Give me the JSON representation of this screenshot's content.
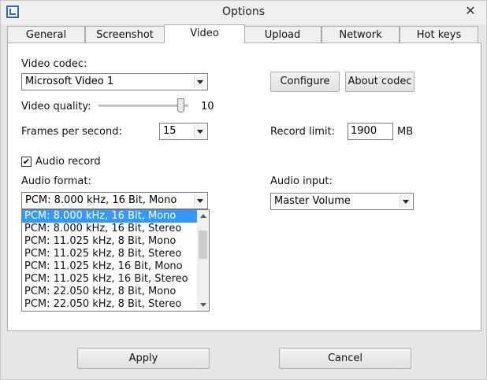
{
  "window": {
    "title": "Options"
  },
  "tabs": [
    {
      "label": "General"
    },
    {
      "label": "Screenshot"
    },
    {
      "label": "Video"
    },
    {
      "label": "Upload"
    },
    {
      "label": "Network"
    },
    {
      "label": "Hot keys"
    }
  ],
  "active_tab": "Video",
  "video": {
    "codec_label": "Video codec:",
    "codec_value": "Microsoft Video 1",
    "configure_label": "Configure",
    "about_codec_label": "About codec",
    "quality_label": "Video quality:",
    "quality_value": "10",
    "quality_fraction": 0.95,
    "fps_label": "Frames per second:",
    "fps_value": "15",
    "record_limit_label": "Record limit:",
    "record_limit_value": "1900",
    "record_limit_unit": "MB"
  },
  "audio": {
    "record_label": "Audio record",
    "record_checked": true,
    "check_glyph": "✔",
    "format_label": "Audio format:",
    "format_value": "PCM: 8.000 kHz, 16 Bit, Mono",
    "input_label": "Audio input:",
    "input_value": "Master Volume",
    "format_options": [
      "PCM: 8.000 kHz, 16 Bit, Mono",
      "PCM: 8.000 kHz, 16 Bit, Stereo",
      "PCM: 11.025 kHz, 8 Bit, Mono",
      "PCM: 11.025 kHz, 8 Bit, Stereo",
      "PCM: 11.025 kHz, 16 Bit, Mono",
      "PCM: 11.025 kHz, 16 Bit, Stereo",
      "PCM: 22.050 kHz, 8 Bit, Mono",
      "PCM: 22.050 kHz, 8 Bit, Stereo"
    ],
    "selected_index": 0
  },
  "footer": {
    "apply_label": "Apply",
    "cancel_label": "Cancel"
  },
  "close_glyph": "✕"
}
